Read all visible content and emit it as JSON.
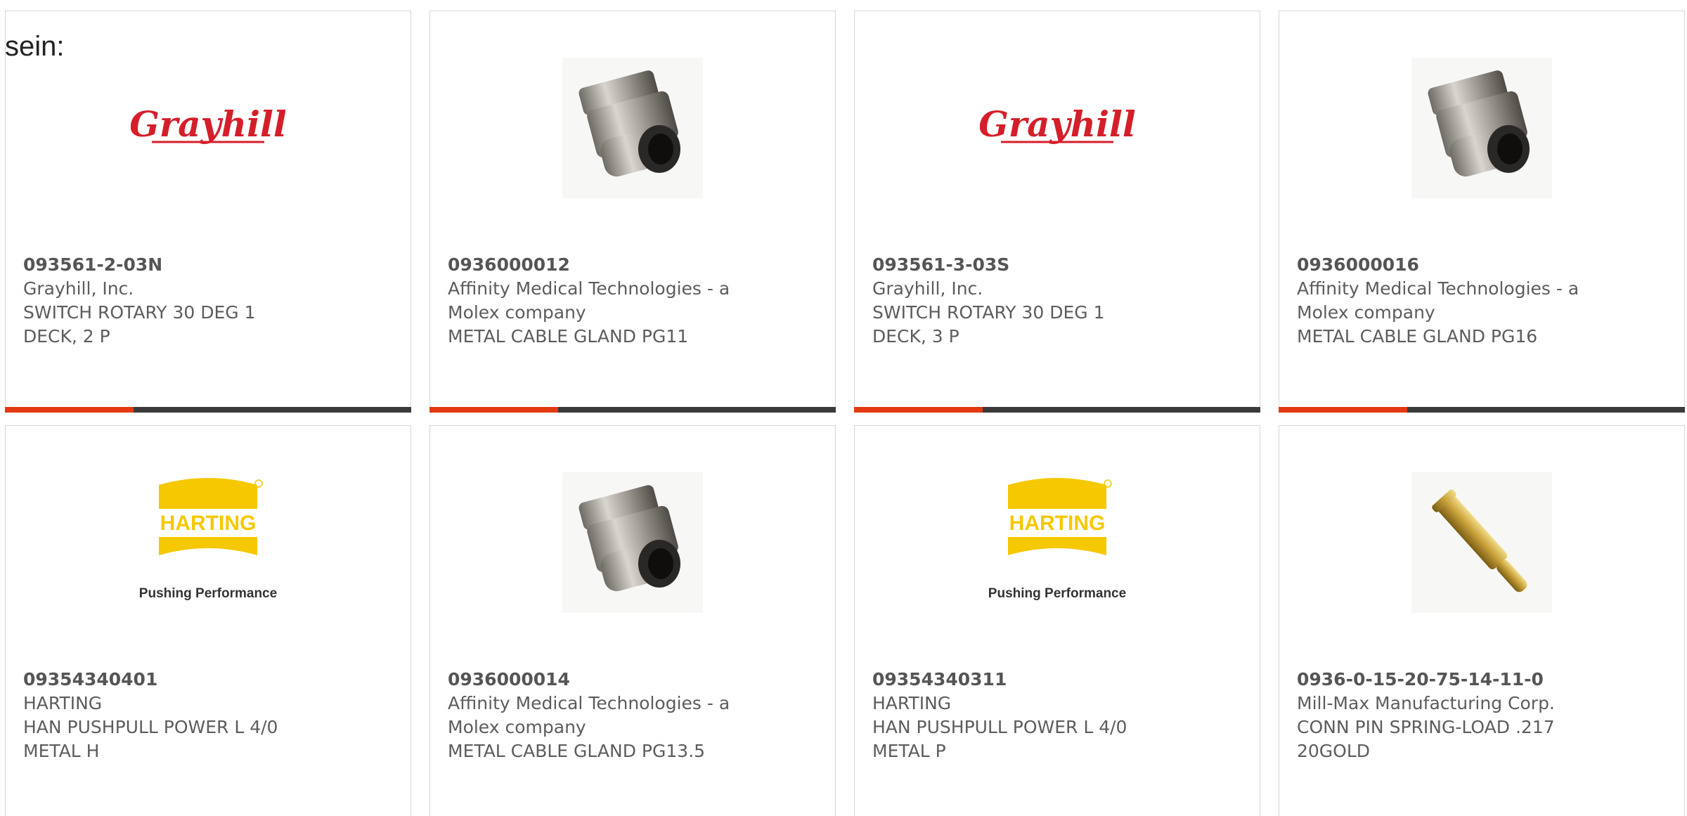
{
  "prefix_text": "sein:",
  "products": [
    {
      "part": "093561-2-03N",
      "manufacturer": "Grayhill, Inc.",
      "desc1": "SWITCH ROTARY 30 DEG 1",
      "desc2": "DECK, 2 P",
      "image": "grayhill-logo",
      "logo_text": "Grayhill"
    },
    {
      "part": "0936000012",
      "manufacturer": "Affinity Medical Technologies - a",
      "desc1": "Molex company",
      "desc2": "METAL CABLE GLAND PG11",
      "image": "cable-gland-photo"
    },
    {
      "part": "093561-3-03S",
      "manufacturer": "Grayhill, Inc.",
      "desc1": "SWITCH ROTARY 30 DEG 1",
      "desc2": "DECK, 3 P",
      "image": "grayhill-logo",
      "logo_text": "Grayhill"
    },
    {
      "part": "0936000016",
      "manufacturer": "Affinity Medical Technologies - a",
      "desc1": "Molex company",
      "desc2": "METAL CABLE GLAND PG16",
      "image": "cable-gland-photo"
    },
    {
      "part": "09354340401",
      "manufacturer": "HARTING",
      "desc1": "HAN PUSHPULL POWER L 4/0",
      "desc2": "METAL H",
      "image": "harting-logo",
      "logo_text": "HARTING",
      "logo_tagline": "Pushing Performance"
    },
    {
      "part": "0936000014",
      "manufacturer": "Affinity Medical Technologies - a",
      "desc1": "Molex company",
      "desc2": "METAL CABLE GLAND PG13.5",
      "image": "cable-gland-photo"
    },
    {
      "part": "09354340311",
      "manufacturer": "HARTING",
      "desc1": "HAN PUSHPULL POWER L 4/0",
      "desc2": "METAL P",
      "image": "harting-logo",
      "logo_text": "HARTING",
      "logo_tagline": "Pushing Performance"
    },
    {
      "part": "0936-0-15-20-75-14-11-0",
      "manufacturer": "Mill-Max Manufacturing Corp.",
      "desc1": "CONN PIN SPRING-LOAD .217",
      "desc2": "20GOLD",
      "image": "spring-pin-photo"
    }
  ],
  "colors": {
    "accent_bar": "#e33a12",
    "dark_bar": "#3b3b3b",
    "grayhill_red": "#d41f2b",
    "harting_yellow": "#f5c800"
  }
}
